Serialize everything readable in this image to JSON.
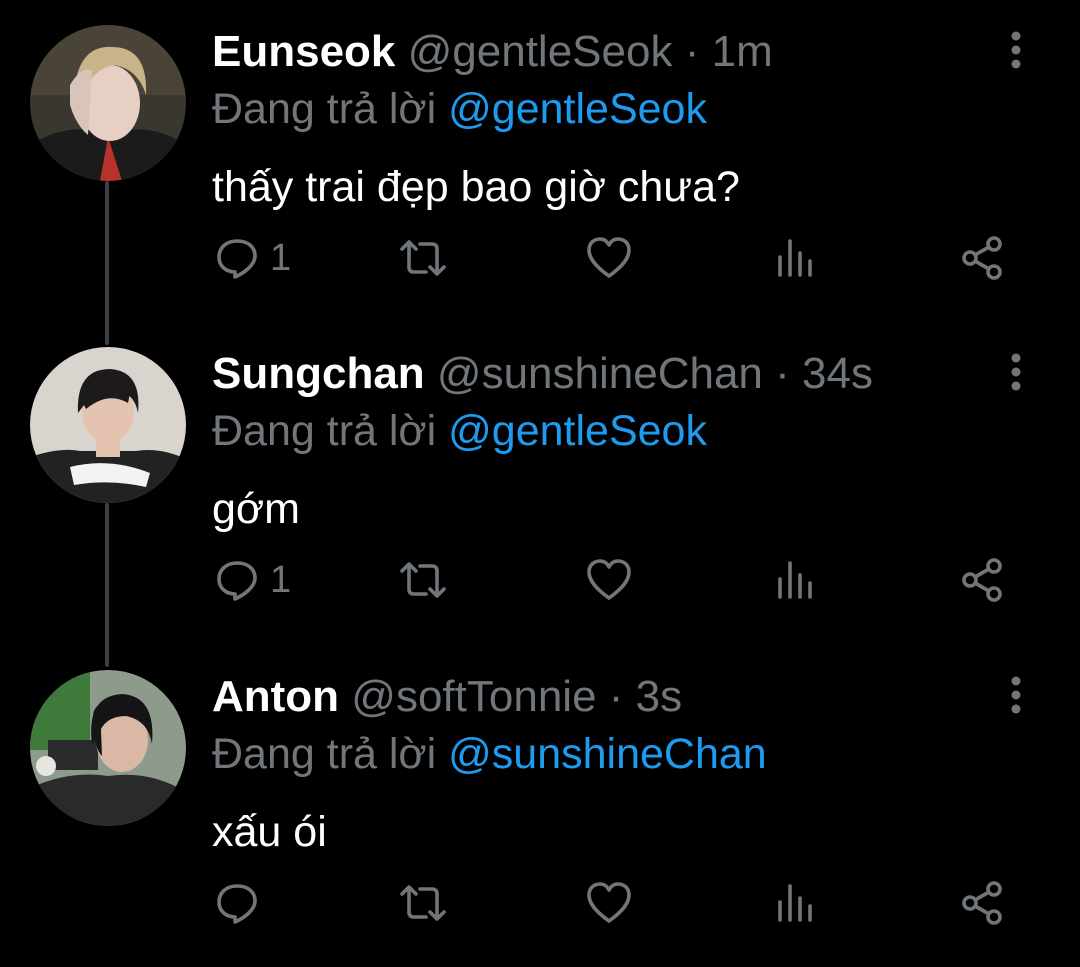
{
  "thread": {
    "tweets": [
      {
        "name": "Eunseok",
        "handle": "@gentleSeok",
        "separator": "·",
        "time": "1m",
        "reply_prefix": "Đang trả lời",
        "reply_to": "@gentleSeok",
        "text": "thấy trai đẹp bao giờ chưa?",
        "reply_count": "1",
        "avatar_colors": {
          "bg": "#3a3630",
          "hair": "#c9b48a",
          "skin": "#e7cfc3",
          "shirt": "#1b1b1b",
          "accent": "#b8322b"
        }
      },
      {
        "name": "Sungchan",
        "handle": "@sunshineChan",
        "separator": "·",
        "time": "34s",
        "reply_prefix": "Đang trả lời",
        "reply_to": "@gentleSeok",
        "text": "gớm",
        "reply_count": "1",
        "avatar_colors": {
          "bg": "#d9d4cd",
          "hair": "#1c1a1a",
          "skin": "#e4c4b0",
          "shirt": "#222222",
          "accent": "#f2f2f2"
        }
      },
      {
        "name": "Anton",
        "handle": "@softTonnie",
        "separator": "·",
        "time": "3s",
        "reply_prefix": "Đang trả lời",
        "reply_to": "@sunshineChan",
        "text": "xấu ói",
        "reply_count": "",
        "avatar_colors": {
          "bg": "#8e9a8c",
          "hair": "#151515",
          "skin": "#d9b9a6",
          "shirt": "#2a2a2a",
          "accent": "#3f7a3a"
        }
      }
    ]
  },
  "icons": {
    "reply": "reply-icon",
    "retweet": "retweet-icon",
    "like": "heart-icon",
    "views": "views-icon",
    "share": "share-icon",
    "more": "more-icon"
  },
  "colors": {
    "background": "#000000",
    "name": "#ffffff",
    "secondary": "#71767b",
    "link": "#1d9bf0",
    "thread_line": "#3a4046"
  }
}
